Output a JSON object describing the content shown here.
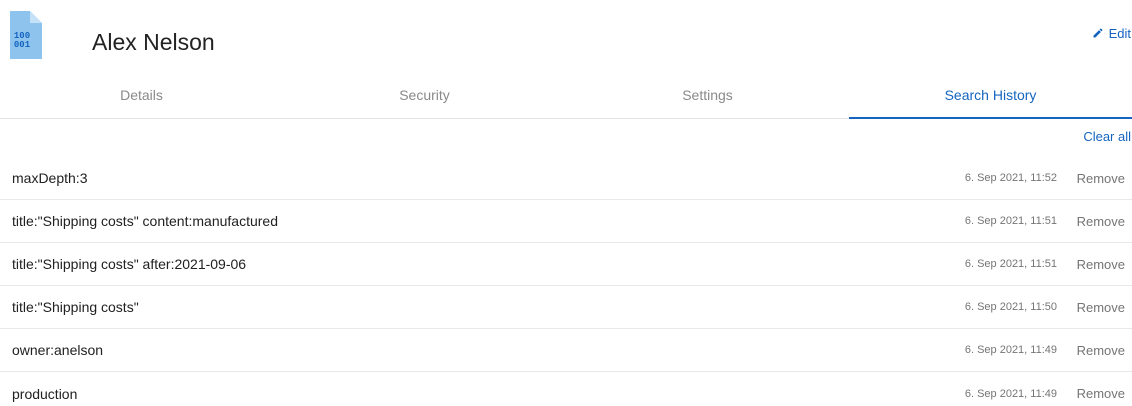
{
  "header": {
    "file_icon_text_top": "100",
    "file_icon_text_bottom": "001",
    "title": "Alex Nelson",
    "edit_label": "Edit",
    "accent": "#1565c0",
    "icon_color": "#8ec3ee"
  },
  "tabs": [
    {
      "label": "Details",
      "active": false
    },
    {
      "label": "Security",
      "active": false
    },
    {
      "label": "Settings",
      "active": false
    },
    {
      "label": "Search History",
      "active": true
    }
  ],
  "actions": {
    "clear_all": "Clear all"
  },
  "history": [
    {
      "query": "maxDepth:3",
      "time": "6. Sep 2021, 11:52",
      "remove": "Remove"
    },
    {
      "query": "title:\"Shipping costs\" content:manufactured",
      "time": "6. Sep 2021, 11:51",
      "remove": "Remove"
    },
    {
      "query": "title:\"Shipping costs\" after:2021-09-06",
      "time": "6. Sep 2021, 11:51",
      "remove": "Remove"
    },
    {
      "query": "title:\"Shipping costs\"",
      "time": "6. Sep 2021, 11:50",
      "remove": "Remove"
    },
    {
      "query": "owner:anelson",
      "time": "6. Sep 2021, 11:49",
      "remove": "Remove"
    },
    {
      "query": "production",
      "time": "6. Sep 2021, 11:49",
      "remove": "Remove"
    }
  ]
}
